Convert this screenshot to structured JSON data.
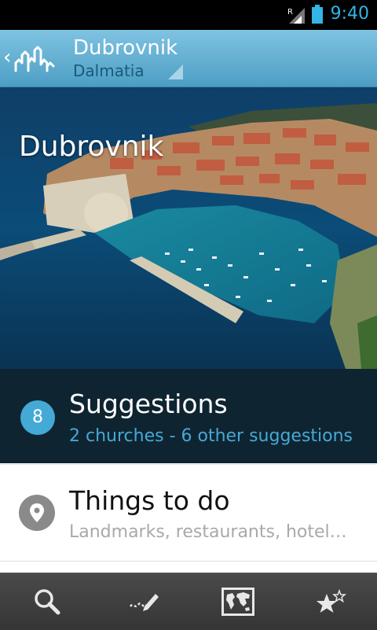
{
  "status_bar": {
    "time": "9:40",
    "roaming": "R",
    "icons": [
      "signal-icon",
      "battery-icon"
    ],
    "accent": "#33b5e5"
  },
  "action_bar": {
    "title": "Dubrovnik",
    "subtitle": "Dalmatia",
    "icons": [
      "back-chevron-icon",
      "app-logo-icon",
      "dropdown-icon"
    ],
    "background": "#5aa9cf"
  },
  "hero": {
    "title": "Dubrovnik"
  },
  "suggestions": {
    "count": "8",
    "title": "Suggestions",
    "subtitle": "2 churches - 6 other suggestions",
    "accent": "#45a9d6"
  },
  "things_to_do": {
    "title": "Things to do",
    "subtitle": "Landmarks, restaurants, hotels ...",
    "icon": "map-pin-icon"
  },
  "bottom_nav": {
    "items": [
      "search-icon",
      "write-note-icon",
      "world-map-icon",
      "favorites-stars-icon"
    ]
  }
}
